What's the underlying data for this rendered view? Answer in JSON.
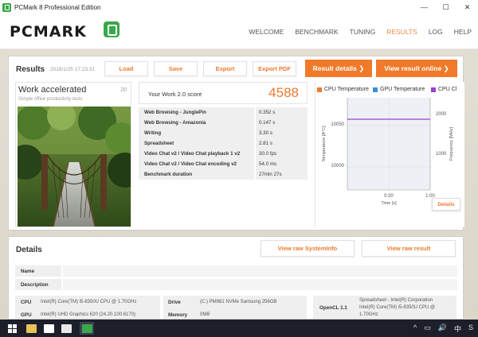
{
  "window": {
    "title": "PCMark 8 Professional Edition",
    "controls": [
      "—",
      "☐",
      "✕"
    ]
  },
  "brand": {
    "logo_text": "PCMARK"
  },
  "nav": {
    "items": [
      "WELCOME",
      "BENCHMARK",
      "TUNING",
      "RESULTS",
      "LOG",
      "HELP"
    ],
    "active": "RESULTS"
  },
  "results": {
    "title": "Results",
    "date": "2019/1/25 17:23:31",
    "buttons": {
      "load": "Load",
      "save": "Save",
      "export": "Export",
      "export_pdf": "Export PDF",
      "result_details": "Result details ❯",
      "view_online": "View result online ❯"
    }
  },
  "work": {
    "title": "Work accelerated",
    "subtitle": "Simple office productivity tests",
    "number": "20"
  },
  "score": {
    "label": "Your Work 2.0 score",
    "value": "4588",
    "rows": [
      {
        "label": "Web Browsing - JunglePin",
        "value": "0.352 s"
      },
      {
        "label": "Web Browsing - Amazonia",
        "value": "0.147 s"
      },
      {
        "label": "Writing",
        "value": "3.30 s"
      },
      {
        "label": "Spreadsheet",
        "value": "2.81 s"
      },
      {
        "label": "Video Chat v2 / Video Chat playback 1 v2",
        "value": "30.0 fps"
      },
      {
        "label": "Video Chat v2 / Video Chat encoding v2",
        "value": "54.0 ms"
      },
      {
        "label": "Benchmark duration",
        "value": "27min 27s"
      }
    ]
  },
  "chart_data": {
    "type": "line",
    "legend": [
      {
        "name": "CPU Temperature",
        "color": "#f07a2a"
      },
      {
        "name": "GPU Temperature",
        "color": "#3b8fd9"
      },
      {
        "name": "CPU Cl",
        "color": "#9b3fd1"
      }
    ],
    "ylabel_left": "Temperature [A°C]",
    "ylabel_right": "Frequency [MHz]",
    "xlabel": "Time [s]",
    "y_left_ticks": [
      "10050",
      "10000"
    ],
    "y_right_ticks": [
      "2000",
      "1000"
    ],
    "x_ticks": [
      "0:30",
      "1:00"
    ],
    "series": [
      {
        "name": "CPU Cl",
        "color": "#9b3fd1",
        "x": [
          0,
          60
        ],
        "values": [
          1900,
          1900
        ],
        "axis": "right"
      }
    ],
    "details_label": "Details"
  },
  "details": {
    "title": "Details",
    "buttons": {
      "raw_sysinfo": "View raw SystemInfo",
      "raw_result": "View raw result"
    },
    "meta": [
      {
        "label": "Name"
      },
      {
        "label": "Description"
      }
    ],
    "sysinfo": {
      "cpu_label": "CPU",
      "cpu_value": "Intel(R) Core(TM) i5-8350U CPU @ 1.70GHz",
      "gpu_label": "GPU",
      "gpu_value": "Intel(R) UHD Graphics 620 (24.20.100.6170)",
      "drive_label": "Drive",
      "drive_value": "(C:) PM981 NVMe Samsung 256GB",
      "memory_label": "Memory",
      "memory_value": "0MB",
      "opencl_label": "OpenCL 1.1",
      "opencl_value_1": "Spreadsheet - Intel(R) Corporation",
      "opencl_value_2": "Intel(R) Core(TM) i5-8350U CPU @",
      "opencl_value_3": "1.70GHz"
    }
  },
  "taskbar": {
    "icons": [
      "windows-icon",
      "store-icon",
      "bag-icon",
      "explorer-icon",
      "pcmark-icon"
    ],
    "tray": [
      "^",
      "▭",
      "🔊",
      "中",
      "S"
    ]
  }
}
